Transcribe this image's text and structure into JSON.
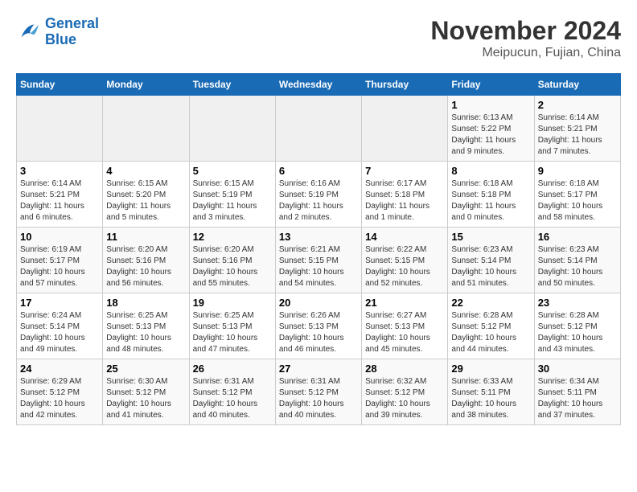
{
  "logo": {
    "line1": "General",
    "line2": "Blue"
  },
  "title": "November 2024",
  "location": "Meipucun, Fujian, China",
  "days_of_week": [
    "Sunday",
    "Monday",
    "Tuesday",
    "Wednesday",
    "Thursday",
    "Friday",
    "Saturday"
  ],
  "weeks": [
    [
      {
        "day": "",
        "info": ""
      },
      {
        "day": "",
        "info": ""
      },
      {
        "day": "",
        "info": ""
      },
      {
        "day": "",
        "info": ""
      },
      {
        "day": "",
        "info": ""
      },
      {
        "day": "1",
        "info": "Sunrise: 6:13 AM\nSunset: 5:22 PM\nDaylight: 11 hours and 9 minutes."
      },
      {
        "day": "2",
        "info": "Sunrise: 6:14 AM\nSunset: 5:21 PM\nDaylight: 11 hours and 7 minutes."
      }
    ],
    [
      {
        "day": "3",
        "info": "Sunrise: 6:14 AM\nSunset: 5:21 PM\nDaylight: 11 hours and 6 minutes."
      },
      {
        "day": "4",
        "info": "Sunrise: 6:15 AM\nSunset: 5:20 PM\nDaylight: 11 hours and 5 minutes."
      },
      {
        "day": "5",
        "info": "Sunrise: 6:15 AM\nSunset: 5:19 PM\nDaylight: 11 hours and 3 minutes."
      },
      {
        "day": "6",
        "info": "Sunrise: 6:16 AM\nSunset: 5:19 PM\nDaylight: 11 hours and 2 minutes."
      },
      {
        "day": "7",
        "info": "Sunrise: 6:17 AM\nSunset: 5:18 PM\nDaylight: 11 hours and 1 minute."
      },
      {
        "day": "8",
        "info": "Sunrise: 6:18 AM\nSunset: 5:18 PM\nDaylight: 11 hours and 0 minutes."
      },
      {
        "day": "9",
        "info": "Sunrise: 6:18 AM\nSunset: 5:17 PM\nDaylight: 10 hours and 58 minutes."
      }
    ],
    [
      {
        "day": "10",
        "info": "Sunrise: 6:19 AM\nSunset: 5:17 PM\nDaylight: 10 hours and 57 minutes."
      },
      {
        "day": "11",
        "info": "Sunrise: 6:20 AM\nSunset: 5:16 PM\nDaylight: 10 hours and 56 minutes."
      },
      {
        "day": "12",
        "info": "Sunrise: 6:20 AM\nSunset: 5:16 PM\nDaylight: 10 hours and 55 minutes."
      },
      {
        "day": "13",
        "info": "Sunrise: 6:21 AM\nSunset: 5:15 PM\nDaylight: 10 hours and 54 minutes."
      },
      {
        "day": "14",
        "info": "Sunrise: 6:22 AM\nSunset: 5:15 PM\nDaylight: 10 hours and 52 minutes."
      },
      {
        "day": "15",
        "info": "Sunrise: 6:23 AM\nSunset: 5:14 PM\nDaylight: 10 hours and 51 minutes."
      },
      {
        "day": "16",
        "info": "Sunrise: 6:23 AM\nSunset: 5:14 PM\nDaylight: 10 hours and 50 minutes."
      }
    ],
    [
      {
        "day": "17",
        "info": "Sunrise: 6:24 AM\nSunset: 5:14 PM\nDaylight: 10 hours and 49 minutes."
      },
      {
        "day": "18",
        "info": "Sunrise: 6:25 AM\nSunset: 5:13 PM\nDaylight: 10 hours and 48 minutes."
      },
      {
        "day": "19",
        "info": "Sunrise: 6:25 AM\nSunset: 5:13 PM\nDaylight: 10 hours and 47 minutes."
      },
      {
        "day": "20",
        "info": "Sunrise: 6:26 AM\nSunset: 5:13 PM\nDaylight: 10 hours and 46 minutes."
      },
      {
        "day": "21",
        "info": "Sunrise: 6:27 AM\nSunset: 5:13 PM\nDaylight: 10 hours and 45 minutes."
      },
      {
        "day": "22",
        "info": "Sunrise: 6:28 AM\nSunset: 5:12 PM\nDaylight: 10 hours and 44 minutes."
      },
      {
        "day": "23",
        "info": "Sunrise: 6:28 AM\nSunset: 5:12 PM\nDaylight: 10 hours and 43 minutes."
      }
    ],
    [
      {
        "day": "24",
        "info": "Sunrise: 6:29 AM\nSunset: 5:12 PM\nDaylight: 10 hours and 42 minutes."
      },
      {
        "day": "25",
        "info": "Sunrise: 6:30 AM\nSunset: 5:12 PM\nDaylight: 10 hours and 41 minutes."
      },
      {
        "day": "26",
        "info": "Sunrise: 6:31 AM\nSunset: 5:12 PM\nDaylight: 10 hours and 40 minutes."
      },
      {
        "day": "27",
        "info": "Sunrise: 6:31 AM\nSunset: 5:12 PM\nDaylight: 10 hours and 40 minutes."
      },
      {
        "day": "28",
        "info": "Sunrise: 6:32 AM\nSunset: 5:12 PM\nDaylight: 10 hours and 39 minutes."
      },
      {
        "day": "29",
        "info": "Sunrise: 6:33 AM\nSunset: 5:11 PM\nDaylight: 10 hours and 38 minutes."
      },
      {
        "day": "30",
        "info": "Sunrise: 6:34 AM\nSunset: 5:11 PM\nDaylight: 10 hours and 37 minutes."
      }
    ]
  ]
}
